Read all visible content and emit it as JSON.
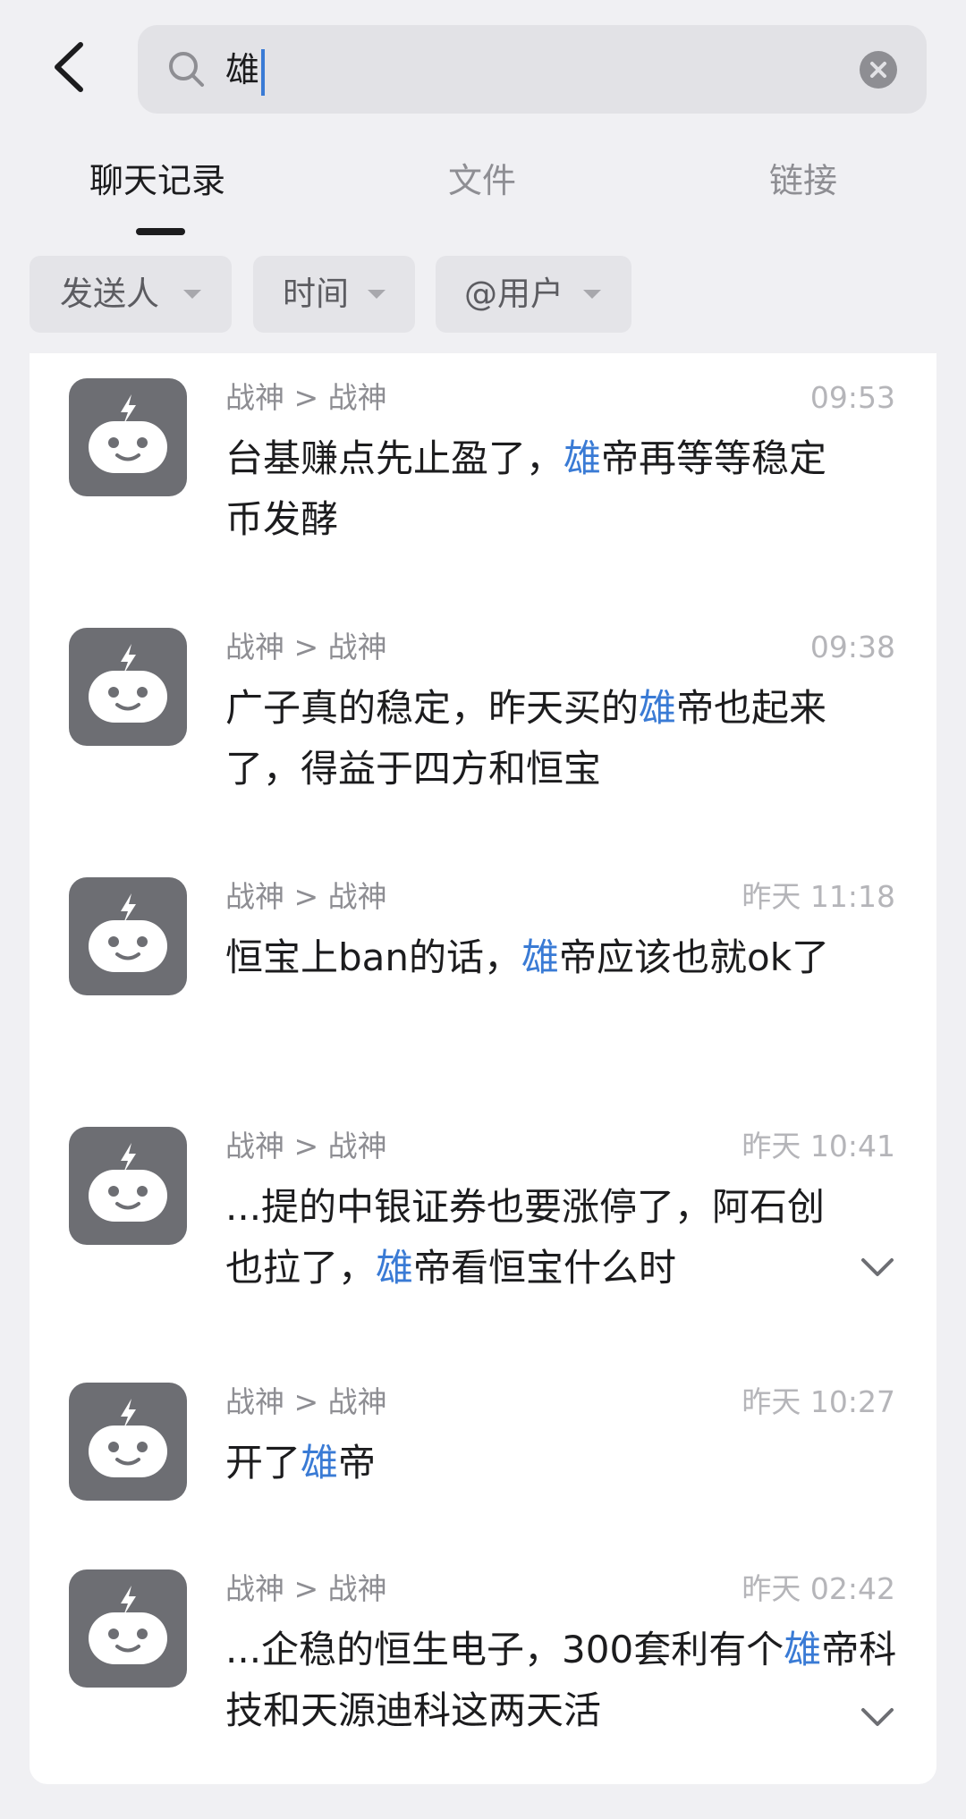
{
  "search": {
    "query": "雄"
  },
  "tabs": [
    {
      "label": "聊天记录",
      "active": true
    },
    {
      "label": "文件",
      "active": false
    },
    {
      "label": "链接",
      "active": false
    }
  ],
  "filters": [
    {
      "label": "发送人"
    },
    {
      "label": "时间"
    },
    {
      "label": "@用户"
    }
  ],
  "colors": {
    "highlight": "#3a7bd5",
    "avatar_bg": "#6d6e73"
  },
  "results": [
    {
      "sender": "战神 > 战神",
      "time": "09:53",
      "pre": "台基赚点先止盈了，",
      "hit": "雄",
      "post": "帝再等等稳定币发酵",
      "expandable": false
    },
    {
      "sender": "战神 > 战神",
      "time": "09:38",
      "pre": "广子真的稳定，昨天买的",
      "hit": "雄",
      "post": "帝也起来了，得益于四方和恒宝",
      "expandable": false
    },
    {
      "sender": "战神 > 战神",
      "time": "昨天 11:18",
      "pre": "恒宝上ban的话，",
      "hit": "雄",
      "post": "帝应该也就ok了",
      "expandable": false
    },
    {
      "sender": "战神 > 战神",
      "time": "昨天 10:41",
      "pre": "...提的中银证券也要涨停了，阿石创也拉了，",
      "hit": "雄",
      "post": "帝看恒宝什么时",
      "expandable": true
    },
    {
      "sender": "战神 > 战神",
      "time": "昨天 10:27",
      "pre": "开了",
      "hit": "雄",
      "post": "帝",
      "expandable": false
    },
    {
      "sender": "战神 > 战神",
      "time": "昨天 02:42",
      "pre": "...企稳的恒生电子，300套利有个",
      "hit": "雄",
      "post": "帝科技和天源迪科这两天活",
      "expandable": true
    }
  ]
}
